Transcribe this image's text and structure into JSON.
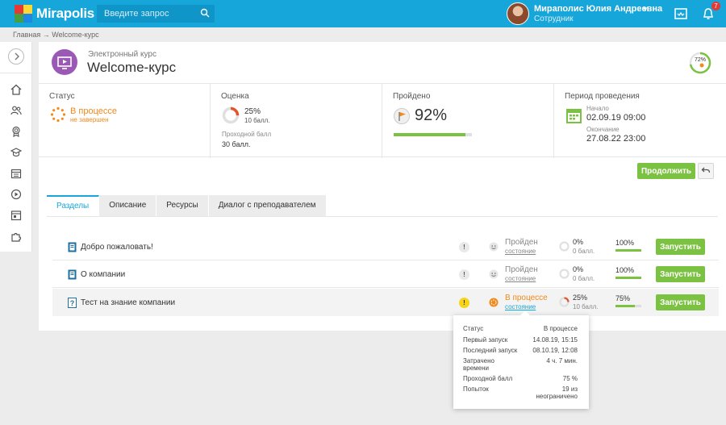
{
  "app": {
    "logo_text": "Mirapolis"
  },
  "search": {
    "placeholder": "Введите запрос"
  },
  "user": {
    "name": "Мираполис Юлия Андреевна",
    "role": "Сотрудник",
    "notifications": "7"
  },
  "breadcrumb": {
    "home": "Главная",
    "separator": "→",
    "current": "Welcome-курс"
  },
  "course": {
    "type": "Электронный курс",
    "title": "Welcome-курс",
    "progress_ring": "72%",
    "progress_value": 0.72
  },
  "stats": {
    "status": {
      "title": "Статус",
      "value": "В процессе",
      "sub": "не завершен"
    },
    "score": {
      "title": "Оценка",
      "value": "25%",
      "value_fraction": 0.25,
      "sub": "10 балл.",
      "pass_label": "Проходной балл",
      "pass_value": "30 балл."
    },
    "passed": {
      "title": "Пройдено",
      "value": "92%",
      "value_fraction": 0.92
    },
    "period": {
      "title": "Период проведения",
      "start_label": "Начало",
      "start_date": "02.09.19",
      "start_time": "09:00",
      "end_label": "Окончание",
      "end_date": "27.08.22",
      "end_time": "23:00"
    }
  },
  "actions": {
    "continue": "Продолжить"
  },
  "tabs": [
    {
      "label": "Разделы"
    },
    {
      "label": "Описание"
    },
    {
      "label": "Ресурсы"
    },
    {
      "label": "Диалог с преподавателем"
    }
  ],
  "sections": [
    {
      "name": "Добро пожаловать!",
      "warn": "!",
      "state": "Пройден",
      "state_link": "состояние",
      "score": "0%",
      "score_fraction": 0,
      "points": "0 балл.",
      "progress": "100%",
      "progress_fraction": 1.0,
      "button": "Запустить"
    },
    {
      "name": "О компании",
      "warn": "!",
      "state": "Пройден",
      "state_link": "состояние",
      "score": "0%",
      "score_fraction": 0,
      "points": "0 балл.",
      "progress": "100%",
      "progress_fraction": 1.0,
      "button": "Запустить"
    },
    {
      "name": "Тест на знание компании",
      "warn": "!",
      "state": "В процессе",
      "state_link": "состояние",
      "score": "25%",
      "score_fraction": 0.25,
      "points": "10 балл.",
      "progress": "75%",
      "progress_fraction": 0.75,
      "button": "Запустить"
    }
  ],
  "tooltip": {
    "rows": [
      {
        "k": "Статус",
        "v": "В процессе"
      },
      {
        "k": "Первый запуск",
        "v": "14.08.19, 15:15"
      },
      {
        "k": "Последний запуск",
        "v": "08.10.19, 12:08"
      },
      {
        "k": "Затрачено времени",
        "v": "4 ч. 7 мин."
      },
      {
        "k": "Проходной балл",
        "v": "75 %"
      },
      {
        "k": "Попыток",
        "v": "19 из неограничено"
      }
    ]
  },
  "colors": {
    "topbar": "#17a6da",
    "accent_green": "#7cc242",
    "accent_orange": "#f08a1c",
    "course_icon": "#9b59b6"
  }
}
